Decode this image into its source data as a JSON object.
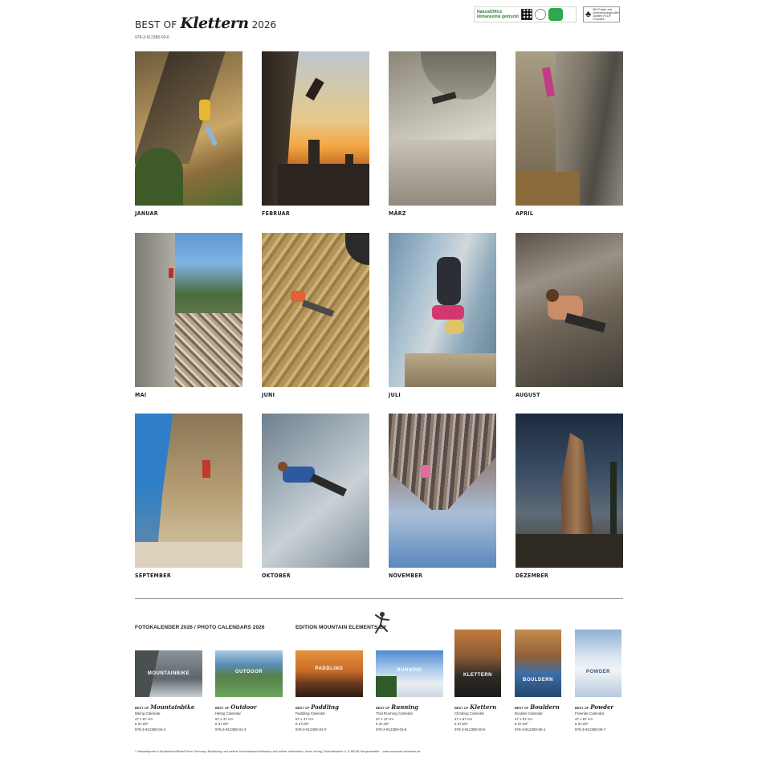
{
  "header": {
    "prefix": "BEST OF",
    "brand": "Klettern",
    "year": "2026",
    "isbn": "978-3-912380-00-6"
  },
  "months": [
    {
      "name": "JANUAR"
    },
    {
      "name": "FEBRUAR"
    },
    {
      "name": "MÄRZ"
    },
    {
      "name": "APRIL"
    },
    {
      "name": "MAI"
    },
    {
      "name": "JUNI"
    },
    {
      "name": "JULI"
    },
    {
      "name": "AUGUST"
    },
    {
      "name": "SEPTEMBER"
    },
    {
      "name": "OKTOBER"
    },
    {
      "name": "NOVEMBER"
    },
    {
      "name": "DEZEMBER"
    }
  ],
  "catalog": {
    "section_left": "FOTOKALENDER 2026 / PHOTO CALENDARS 2026",
    "section_right": "EDITION MOUNTAIN ELEMENTS BY",
    "items": [
      {
        "prefix": "BEST OF",
        "name": "Mountainbike",
        "sub": "Biking Calendar",
        "size": "47 x 67 cm",
        "price": "€ 37,00*",
        "isbn": "978-3-912380-04-4",
        "thumb_label": "MOUNTAINBIKE"
      },
      {
        "prefix": "BEST OF",
        "name": "Outdoor",
        "sub": "Hiking Calendar",
        "size": "67 x 47 cm",
        "price": "€ 37,00*",
        "isbn": "978-3-912380-01-3",
        "thumb_label": "OUTDOOR"
      },
      {
        "prefix": "BEST OF",
        "name": "Paddling",
        "sub": "Paddling Calendar",
        "size": "67 x 47 cm",
        "price": "€ 37,00*",
        "isbn": "978-3-912380-02-0",
        "thumb_label": "PADDLING"
      },
      {
        "prefix": "BEST OF",
        "name": "Running",
        "sub": "Trail Running Calendar",
        "size": "67 x 47 cm",
        "price": "€ 37,00*",
        "isbn": "978-3-912380-03-8",
        "thumb_label": "RUNNING"
      },
      {
        "prefix": "BEST OF",
        "name": "Klettern",
        "sub": "Climbing Calendar",
        "size": "47 x 67 cm",
        "price": "€ 37,00*",
        "isbn": "978-3-912380-00-6",
        "thumb_label": "KLETTERN"
      },
      {
        "prefix": "BEST OF",
        "name": "Bouldern",
        "sub": "Boulder Calendar",
        "size": "47 x 67 cm",
        "price": "€ 37,00*",
        "isbn": "978-3-912380-05-1",
        "thumb_label": "BOULDERN"
      },
      {
        "prefix": "BEST OF",
        "name": "Powder",
        "sub": "Freeride Calendar",
        "size": "47 x 67 cm",
        "price": "€ 37,00*",
        "isbn": "978-3-912380-06-7",
        "thumb_label": "POWDER"
      }
    ]
  },
  "logos": {
    "eco_text": "NaturalOffice klimaneutral gedruckt",
    "fsc_text": "MIX Papier aus verantwortungsvollen Quellen FSC® C104645"
  },
  "footnote": "* Verkaufspreis in Deutschland/Retail Price Germany. Bestellung und weitere Informationen/Webshop and further information: Innes Verlag, Schindleweiler 9, D-88138 Hergensweiler – www.mountain-elements.de"
}
